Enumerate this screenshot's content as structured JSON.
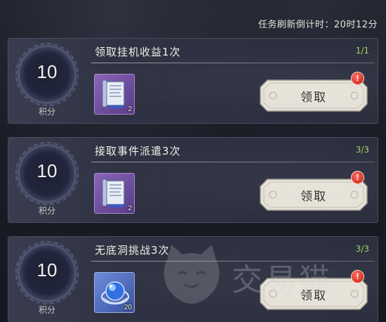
{
  "header": {
    "timer_label": "任务刷新倒计时：20时12分"
  },
  "tasks": [
    {
      "score": "10",
      "score_label": "积分",
      "title": "领取挂机收益1次",
      "progress": "1/1",
      "reward": {
        "icon": "scroll-book-icon",
        "count": "2",
        "rarity_color": "#7a57a8"
      },
      "claim_label": "领取",
      "alert": "!"
    },
    {
      "score": "10",
      "score_label": "积分",
      "title": "接取事件派遣3次",
      "progress": "3/3",
      "reward": {
        "icon": "scroll-book-icon",
        "count": "2",
        "rarity_color": "#7a57a8"
      },
      "claim_label": "领取",
      "alert": "!"
    },
    {
      "score": "10",
      "score_label": "积分",
      "title": "无底洞挑战3次",
      "progress": "3/3",
      "reward": {
        "icon": "crystal-orb-icon",
        "count": "20",
        "rarity_color": "#4d69b8"
      },
      "claim_label": "领取",
      "alert": "!"
    }
  ],
  "watermark": {
    "text": "交易猫",
    "icon": "cat-logo-icon"
  },
  "colors": {
    "progress_green": "#9ed36a",
    "alert_red": "#d52a1e",
    "card_bg": "#2f3242"
  }
}
